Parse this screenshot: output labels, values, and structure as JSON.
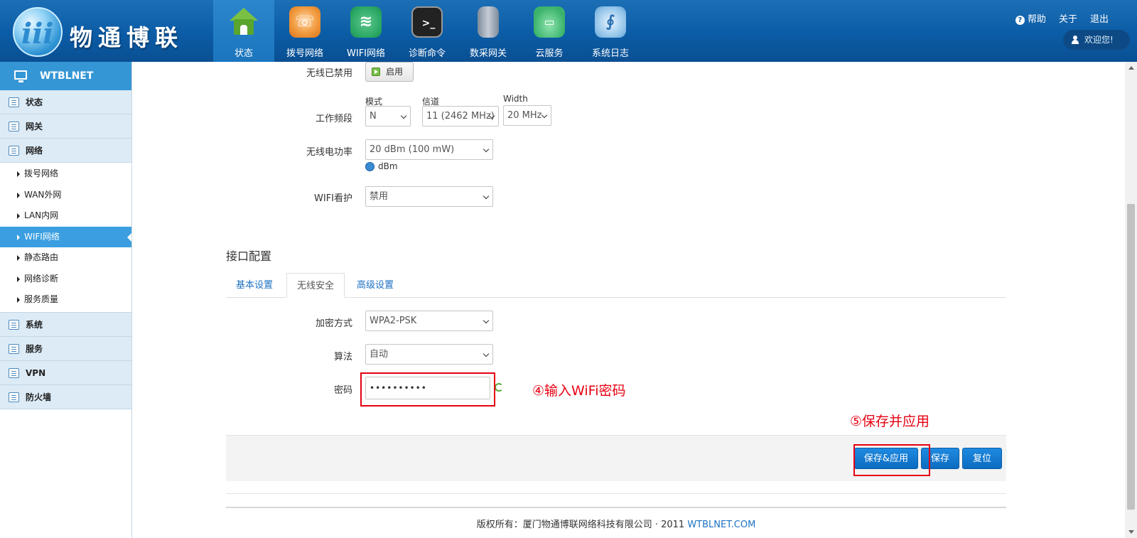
{
  "brand": {
    "name": "物通博联"
  },
  "topnav": [
    {
      "label": "状态",
      "icon": "home-icon"
    },
    {
      "label": "拨号网络",
      "icon": "dial-icon"
    },
    {
      "label": "WIFI网络",
      "icon": "wifi-icon"
    },
    {
      "label": "诊断命令",
      "icon": "terminal-icon"
    },
    {
      "label": "数采网关",
      "icon": "gateway-icon"
    },
    {
      "label": "云服务",
      "icon": "cloud-icon"
    },
    {
      "label": "系统日志",
      "icon": "stethoscope-icon"
    }
  ],
  "top_right": {
    "help": "帮助",
    "about": "关于",
    "logout": "退出",
    "welcome": "欢迎您!"
  },
  "sidebar": {
    "title": "WTBLNET",
    "groups_top": [
      "状态",
      "网关",
      "网络"
    ],
    "network_items": [
      "拨号网络",
      "WAN外网",
      "LAN内网",
      "WIFI网络",
      "静态路由",
      "网络诊断",
      "服务质量"
    ],
    "active_item": "WIFI网络",
    "groups_bottom": [
      "系统",
      "服务",
      "VPN",
      "防火墙"
    ]
  },
  "device_config": {
    "wireless_disabled_label": "无线已禁用",
    "enable_button": "启用",
    "band_label": "工作频段",
    "mode_label": "模式",
    "mode_value": "N",
    "channel_label": "信道",
    "channel_value": "11 (2462 MHz)",
    "width_label": "Width",
    "width_value": "20 MHz",
    "power_label": "无线电功率",
    "power_value": "20 dBm (100 mW)",
    "power_unit": "dBm",
    "watchdog_label": "WIFI看护",
    "watchdog_value": "禁用"
  },
  "interface": {
    "title": "接口配置",
    "tabs": [
      "基本设置",
      "无线安全",
      "高级设置"
    ],
    "active_tab": "无线安全",
    "encryption_label": "加密方式",
    "encryption_value": "WPA2-PSK",
    "cipher_label": "算法",
    "cipher_value": "自动",
    "password_label": "密码",
    "password_value": "••••••••••"
  },
  "annotations": {
    "step4": "④输入WiFi密码",
    "step5": "⑤保存并应用",
    "color": "#e60012"
  },
  "actions": {
    "save_apply": "保存&应用",
    "save": "保存",
    "reset": "复位"
  },
  "footer": {
    "text": "版权所有：厦门物通博联网络科技有限公司 · 2011",
    "link": "WTBLNET.COM"
  },
  "colors": {
    "header": "#0b5ca6",
    "sidebar_head": "#3596d5",
    "active_item": "#3a9ee0",
    "button": "#0b6cc0"
  }
}
